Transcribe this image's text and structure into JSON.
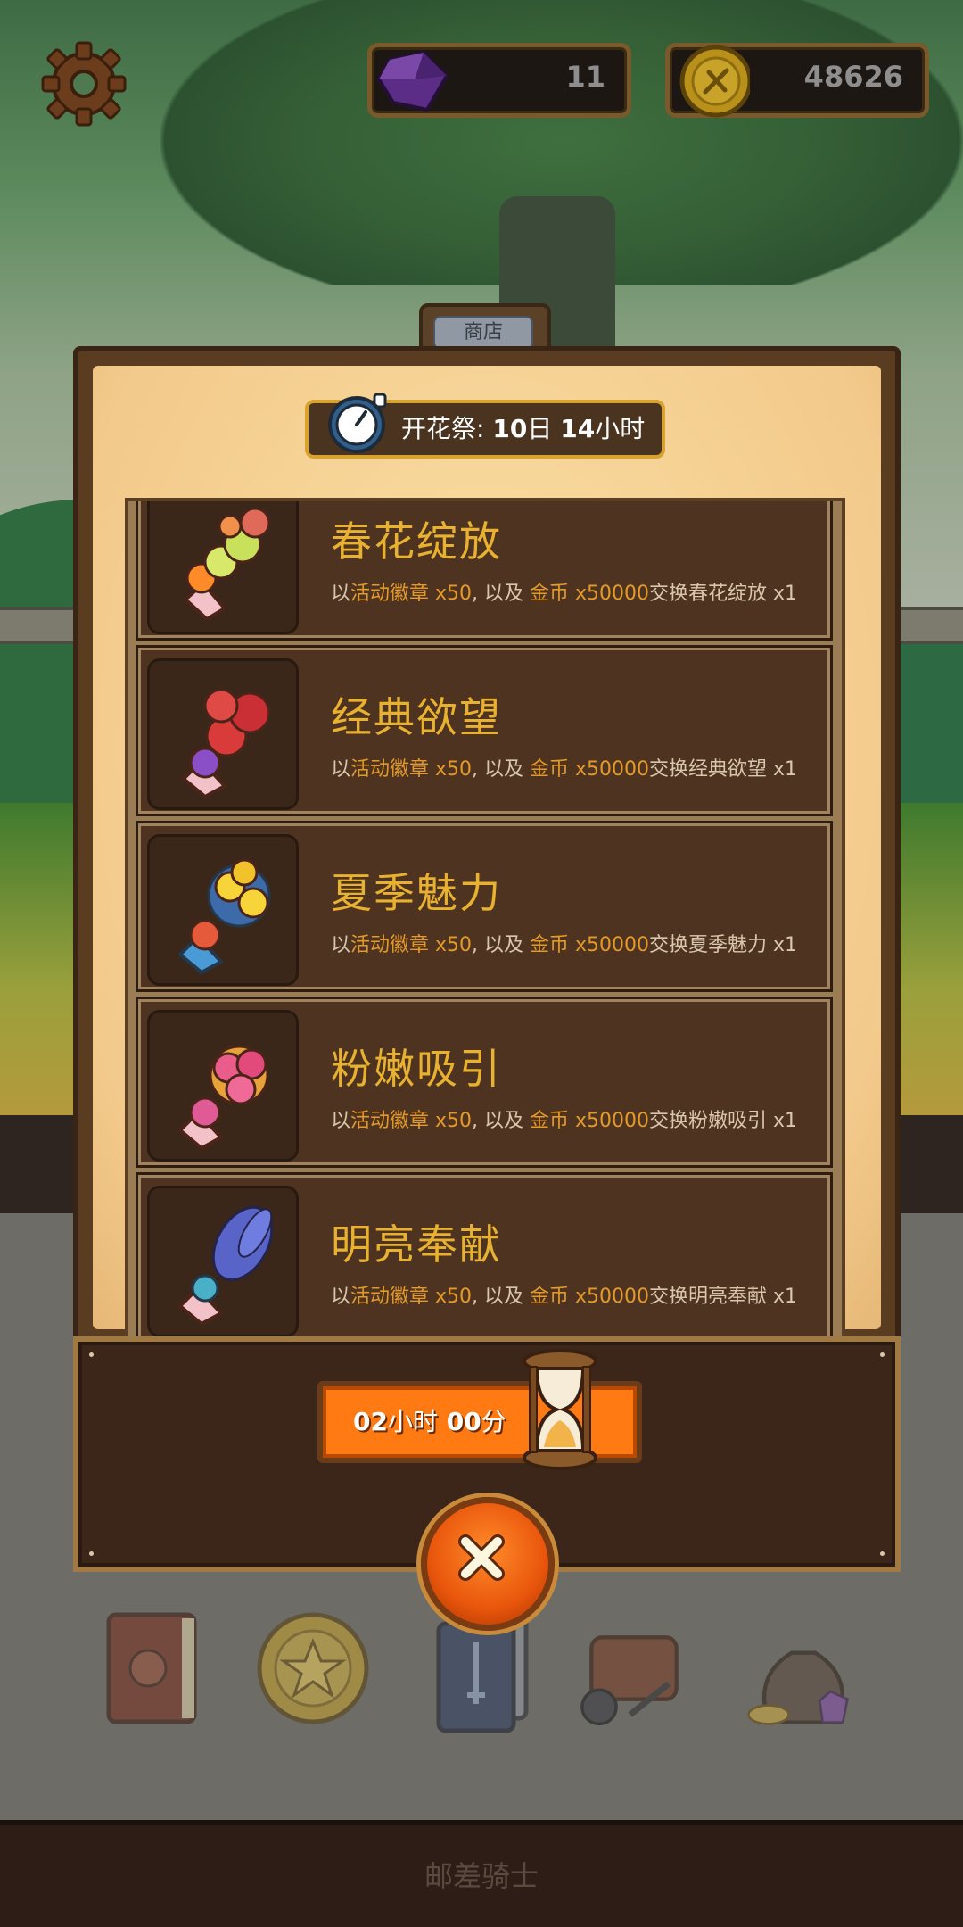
{
  "hud": {
    "gems": "11",
    "coins": "48626"
  },
  "shop": {
    "tab_label": "商店",
    "event_name": "开花祭:",
    "event_days": "10",
    "event_days_unit": "日",
    "event_hours": "14",
    "event_hours_unit": "小时",
    "items": [
      {
        "name": "春花绽放",
        "desc_prefix": "以",
        "desc_badge": "活动徽章 x50",
        "desc_mid": ", 以及 ",
        "desc_coin": "金币 x50000",
        "desc_suffix": "交换春花绽放 x1",
        "icon": "spring-bouquet-icon"
      },
      {
        "name": "经典欲望",
        "desc_prefix": "以",
        "desc_badge": "活动徽章 x50",
        "desc_mid": ", 以及 ",
        "desc_coin": "金币 x50000",
        "desc_suffix": "交换经典欲望 x1",
        "icon": "rose-bouquet-icon"
      },
      {
        "name": "夏季魅力",
        "desc_prefix": "以",
        "desc_badge": "活动徽章 x50",
        "desc_mid": ", 以及 ",
        "desc_coin": "金币 x50000",
        "desc_suffix": "交换夏季魅力 x1",
        "icon": "daffodil-bouquet-icon"
      },
      {
        "name": "粉嫩吸引",
        "desc_prefix": "以",
        "desc_badge": "活动徽章 x50",
        "desc_mid": ", 以及 ",
        "desc_coin": "金币 x50000",
        "desc_suffix": "交换粉嫩吸引 x1",
        "icon": "pink-bouquet-icon"
      },
      {
        "name": "明亮奉献",
        "desc_prefix": "以",
        "desc_badge": "活动徽章 x50",
        "desc_mid": ", 以及 ",
        "desc_coin": "金币 x50000",
        "desc_suffix": "交换明亮奉献 x1",
        "icon": "lavender-bouquet-icon"
      }
    ],
    "refresh_hours": "02",
    "refresh_hours_unit": "小时",
    "refresh_minutes": "00",
    "refresh_minutes_unit": "分"
  },
  "footer": {
    "title": "邮差骑士"
  },
  "colors": {
    "item_name": "#e8b130",
    "highlight": "#e39a2a",
    "refresh_button": "#ff7a12",
    "close_button": "#e9560c"
  }
}
